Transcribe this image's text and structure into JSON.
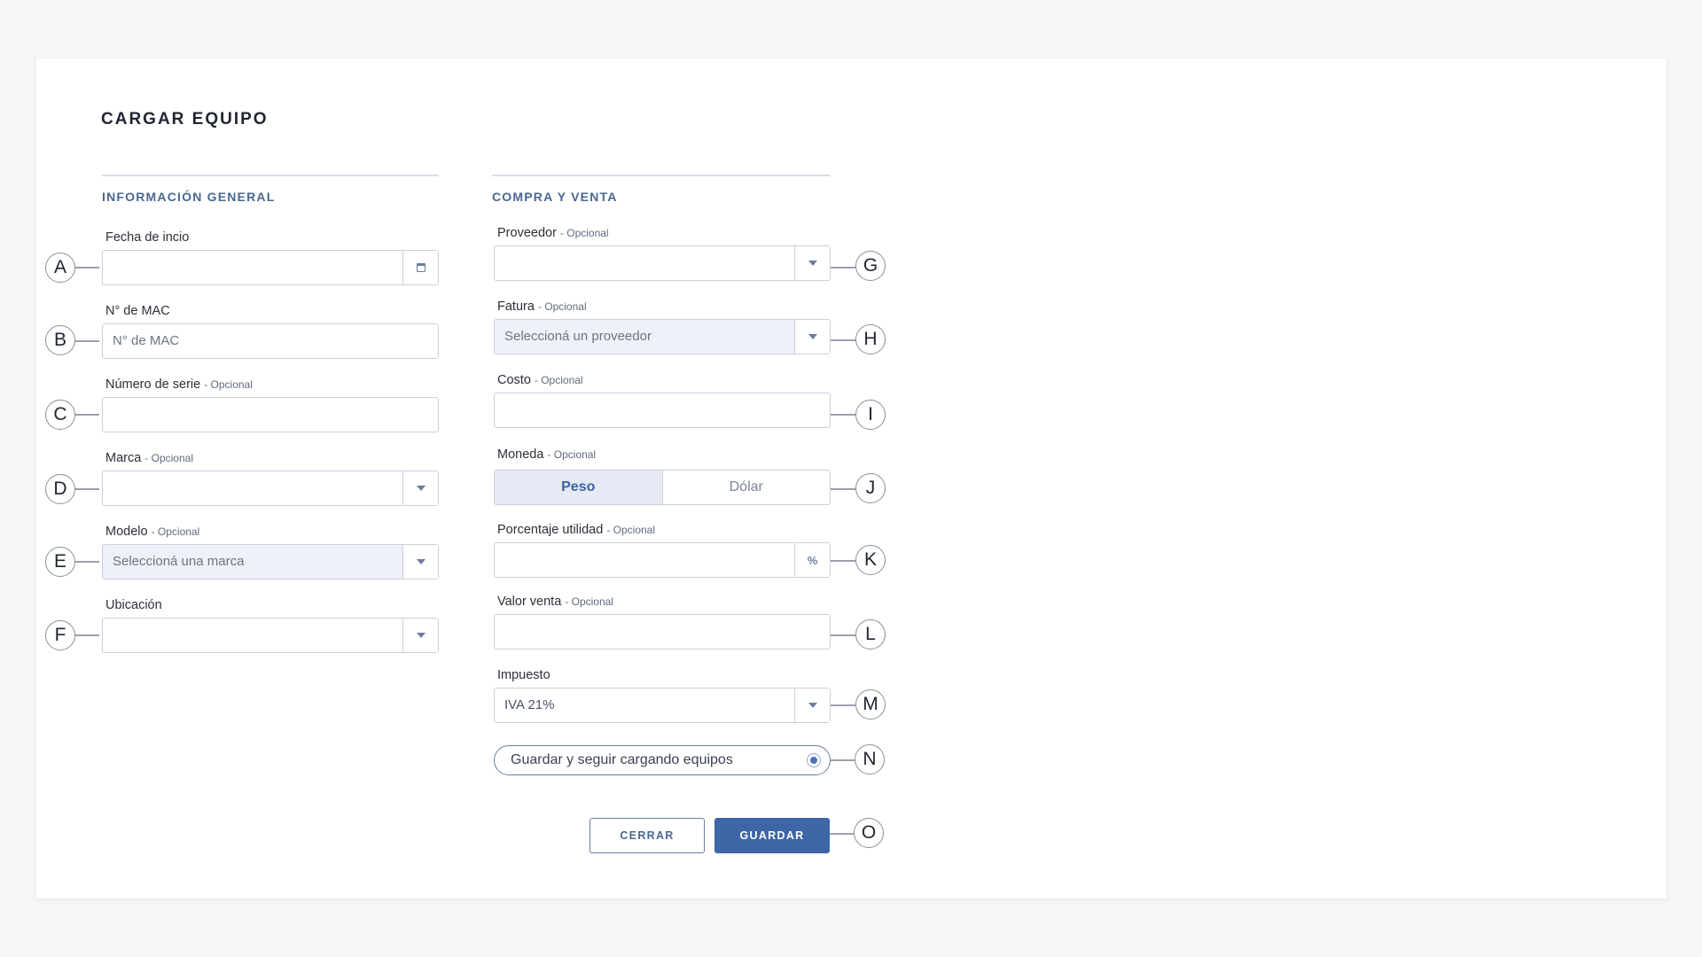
{
  "page": {
    "title": "CARGAR EQUIPO"
  },
  "sections": {
    "general": "INFORMACIÓN GENERAL",
    "compra": "COMPRA Y VENTA"
  },
  "optional_tag": "- Opcional",
  "fields": {
    "fecha_inicio": {
      "label": "Fecha de incio",
      "value": ""
    },
    "mac": {
      "label": "N° de MAC",
      "placeholder": "N° de MAC"
    },
    "numero_serie": {
      "label": "Número de serie",
      "value": ""
    },
    "marca": {
      "label": "Marca",
      "value": ""
    },
    "modelo": {
      "label": "Modelo",
      "value": "Seleccioná una marca"
    },
    "ubicacion": {
      "label": "Ubicación",
      "value": ""
    },
    "proveedor": {
      "label": "Proveedor",
      "value": ""
    },
    "fatura": {
      "label": "Fatura",
      "value": "Seleccioná un proveedor"
    },
    "costo": {
      "label": "Costo",
      "value": ""
    },
    "moneda": {
      "label": "Moneda",
      "options": [
        "Peso",
        "Dólar"
      ],
      "selected": "Peso"
    },
    "porcentaje": {
      "label": "Porcentaje utilidad",
      "suffix": "%",
      "value": ""
    },
    "valor_venta": {
      "label": "Valor venta",
      "value": ""
    },
    "impuesto": {
      "label": "Impuesto",
      "value": "IVA 21%"
    }
  },
  "keep_loading": {
    "label": "Guardar y seguir cargando equipos",
    "checked": true
  },
  "buttons": {
    "close": "CERRAR",
    "save": "GUARDAR"
  },
  "callouts": [
    "A",
    "B",
    "C",
    "D",
    "E",
    "F",
    "G",
    "H",
    "I",
    "J",
    "K",
    "L",
    "M",
    "N",
    "O"
  ],
  "colors": {
    "accent": "#3e66a6",
    "section_title": "#4a6890",
    "filled_bg": "#eef1f8"
  },
  "icons": {
    "calendar": "calendar-icon",
    "dropdown": "chevron-down-icon",
    "percent": "percent-icon"
  }
}
